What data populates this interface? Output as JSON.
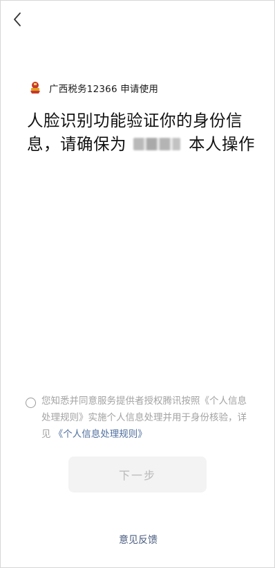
{
  "nav": {
    "back_icon": "chevron-left-icon"
  },
  "app": {
    "logo_icon": "tax-bureau-logo-icon",
    "name": "广西税务12366 申请使用"
  },
  "title": {
    "part1": "人脸识别功能验证你的身份信息，请确保为",
    "masked_name": "",
    "part2": "本人操作"
  },
  "consent": {
    "text": "您知悉并同意服务提供者授权腾讯按照《个人信息处理规则》实施个人信息处理并用于身份核验，详见",
    "link_label": "《个人信息处理规则》",
    "checked": false
  },
  "next_button": {
    "label": "下一步",
    "enabled": false
  },
  "feedback": {
    "label": "意见反馈"
  },
  "colors": {
    "link": "#4f6f9f",
    "disabled_button_bg": "#f3f3f3",
    "disabled_button_text": "#b9b9b9"
  }
}
